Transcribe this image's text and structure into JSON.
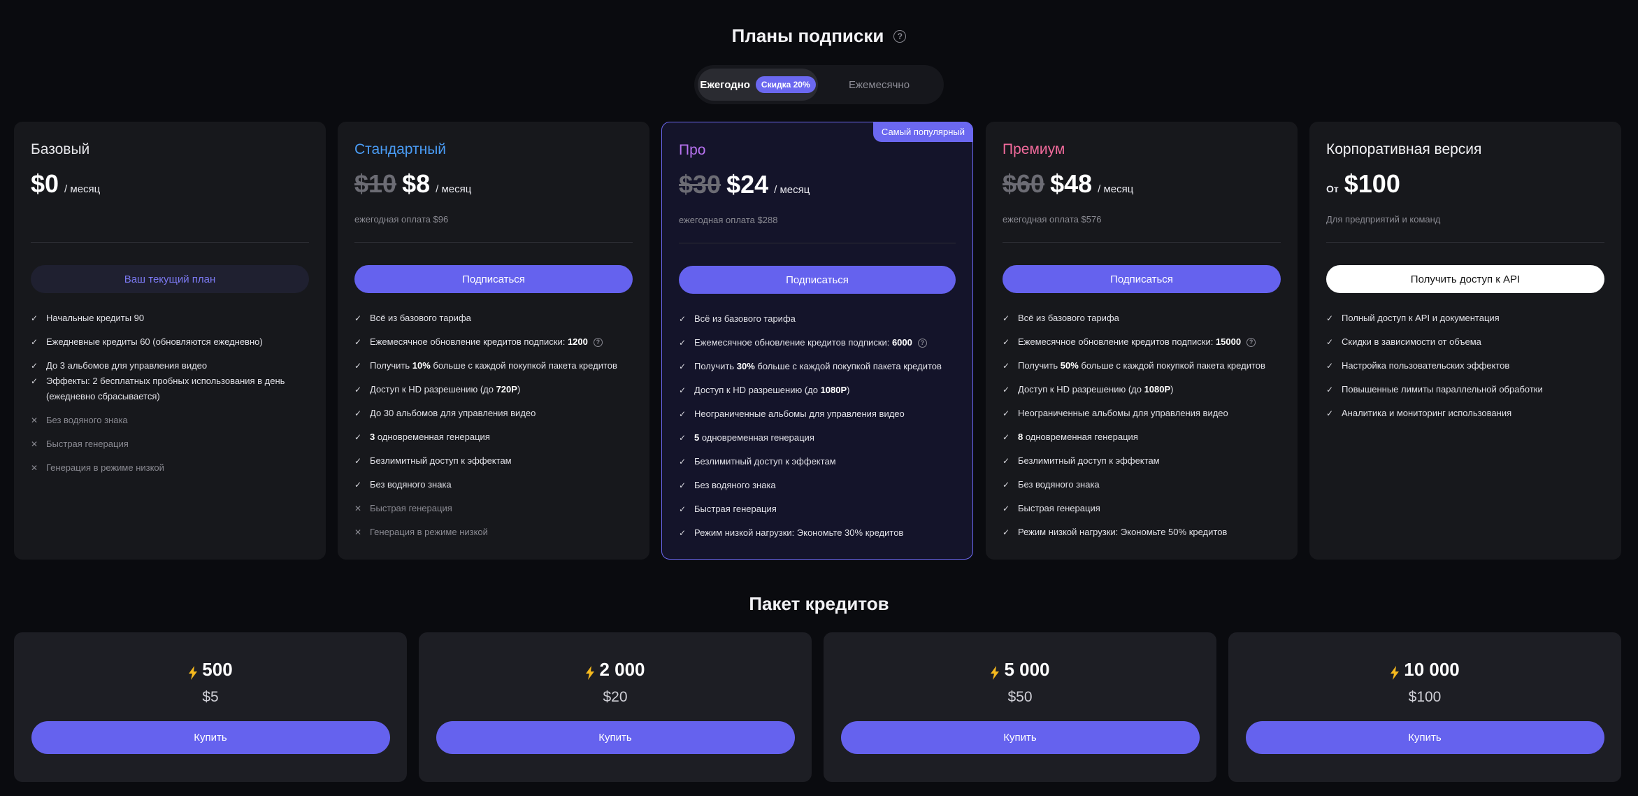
{
  "header": {
    "title": "Планы подписки"
  },
  "billing_toggle": {
    "annual_label": "Ежегодно",
    "discount_badge": "Скидка 20%",
    "monthly_label": "Ежемесячно"
  },
  "plans": [
    {
      "name": "Базовый",
      "name_color": "#e6e6ea",
      "price_old": "",
      "price_new": "$0",
      "price_unit": "/ месяц",
      "annual_note": "",
      "button": "Ваш текущий план",
      "features": [
        {
          "text": "Начальные кредиты 90",
          "on": true,
          "help": true
        },
        {
          "text": "Ежедневные кредиты 60 (обновляются ежедневно)",
          "on": true,
          "help": true
        },
        {
          "text": "До 3 альбомов для управления видео",
          "on": true
        },
        {
          "text": "Эффекты: 2 бесплатных пробных использования в день (ежедневно сбрасывается)",
          "on": true
        },
        {
          "text": "Без водяного знака",
          "on": false
        },
        {
          "text": "Быстрая генерация",
          "on": false
        },
        {
          "text": "Генерация в режиме низкой",
          "on": false
        }
      ]
    },
    {
      "name": "Стандартный",
      "name_color": "#4a9cf5",
      "price_old": "$10",
      "price_new": "$8",
      "price_unit": "/ месяц",
      "annual_note": "ежегодная оплата $96",
      "button": "Подписаться",
      "features": [
        {
          "text": "Всё из базового тарифа",
          "on": true
        },
        {
          "pre": "Ежемесячное обновление кредитов подписки: ",
          "bold": "1200",
          "post": "",
          "on": true,
          "help": true
        },
        {
          "pre": "Получить ",
          "bold": "10%",
          "post": " больше с каждой покупкой пакета кредитов",
          "on": true
        },
        {
          "pre": "Доступ к HD разрешению (до ",
          "bold": "720P",
          "post": ")",
          "on": true
        },
        {
          "text": "До 30 альбомов для управления видео",
          "on": true
        },
        {
          "pre": "",
          "bold": "3",
          "post": " одновременная генерация",
          "on": true
        },
        {
          "text": "Безлимитный доступ к эффектам",
          "on": true
        },
        {
          "text": "Без водяного знака",
          "on": true
        },
        {
          "text": "Быстрая генерация",
          "on": false
        },
        {
          "text": "Генерация в режиме низкой",
          "on": false
        }
      ]
    },
    {
      "name": "Про",
      "name_color": "#b772f0",
      "badge": "Самый популярный",
      "price_old": "$30",
      "price_new": "$24",
      "price_unit": "/ месяц",
      "annual_note": "ежегодная оплата $288",
      "button": "Подписаться",
      "features": [
        {
          "text": "Всё из базового тарифа",
          "on": true
        },
        {
          "pre": "Ежемесячное обновление кредитов подписки: ",
          "bold": "6000",
          "post": "",
          "on": true,
          "help": true
        },
        {
          "pre": "Получить ",
          "bold": "30%",
          "post": " больше с каждой покупкой пакета кредитов",
          "on": true
        },
        {
          "pre": "Доступ к HD разрешению (до ",
          "bold": "1080P",
          "post": ")",
          "on": true
        },
        {
          "text": "Неограниченные альбомы для управления видео",
          "on": true
        },
        {
          "pre": "",
          "bold": "5",
          "post": " одновременная генерация",
          "on": true
        },
        {
          "text": "Безлимитный доступ к эффектам",
          "on": true
        },
        {
          "text": "Без водяного знака",
          "on": true
        },
        {
          "text": "Быстрая генерация",
          "on": true
        },
        {
          "text": "Режим низкой нагрузки: Экономьте 30% кредитов",
          "on": true
        }
      ]
    },
    {
      "name": "Премиум",
      "name_color": "#f06a9b",
      "price_old": "$60",
      "price_new": "$48",
      "price_unit": "/ месяц",
      "annual_note": "ежегодная оплата $576",
      "button": "Подписаться",
      "features": [
        {
          "text": "Всё из базового тарифа",
          "on": true
        },
        {
          "pre": "Ежемесячное обновление кредитов подписки: ",
          "bold": "15000",
          "post": "",
          "on": true,
          "help": true
        },
        {
          "pre": "Получить ",
          "bold": "50%",
          "post": " больше с каждой покупкой пакета кредитов",
          "on": true
        },
        {
          "pre": "Доступ к HD разрешению (до ",
          "bold": "1080P",
          "post": ")",
          "on": true
        },
        {
          "text": "Неограниченные альбомы для управления видео",
          "on": true
        },
        {
          "pre": "",
          "bold": "8",
          "post": " одновременная генерация",
          "on": true
        },
        {
          "text": "Безлимитный доступ к эффектам",
          "on": true
        },
        {
          "text": "Без водяного знака",
          "on": true
        },
        {
          "text": "Быстрая генерация",
          "on": true
        },
        {
          "text": "Режим низкой нагрузки: Экономьте 50% кредитов",
          "on": true
        }
      ]
    },
    {
      "name": "Корпоративная версия",
      "name_color": "#f2f2f5",
      "price_prefix": "От",
      "price_old": "",
      "price_new": "$100",
      "price_unit": "",
      "annual_note": "Для предприятий и команд",
      "button": "Получить доступ к API",
      "features": [
        {
          "text": "Полный доступ к API и документация",
          "on": true
        },
        {
          "text": "Скидки в зависимости от объема",
          "on": true
        },
        {
          "text": "Настройка пользовательских эффектов",
          "on": true
        },
        {
          "text": "Повышенные лимиты параллельной обработки",
          "on": true
        },
        {
          "text": "Аналитика и мониторинг использования",
          "on": true
        }
      ]
    }
  ],
  "credits_section": {
    "title": "Пакет кредитов",
    "packs": [
      {
        "amount": "500",
        "price": "$5",
        "button": "Купить"
      },
      {
        "amount": "2 000",
        "price": "$20",
        "button": "Купить"
      },
      {
        "amount": "5 000",
        "price": "$50",
        "button": "Купить"
      },
      {
        "amount": "10 000",
        "price": "$100",
        "button": "Купить"
      }
    ]
  },
  "colors": {
    "accent": "#6562ee",
    "background": "#0a0b0f",
    "card": "#17181c",
    "bolt": "#f5b91e"
  },
  "icons": {
    "check": "check-icon",
    "cross": "x-icon",
    "help": "question-circle-icon",
    "bolt": "lightning-bolt-icon"
  }
}
